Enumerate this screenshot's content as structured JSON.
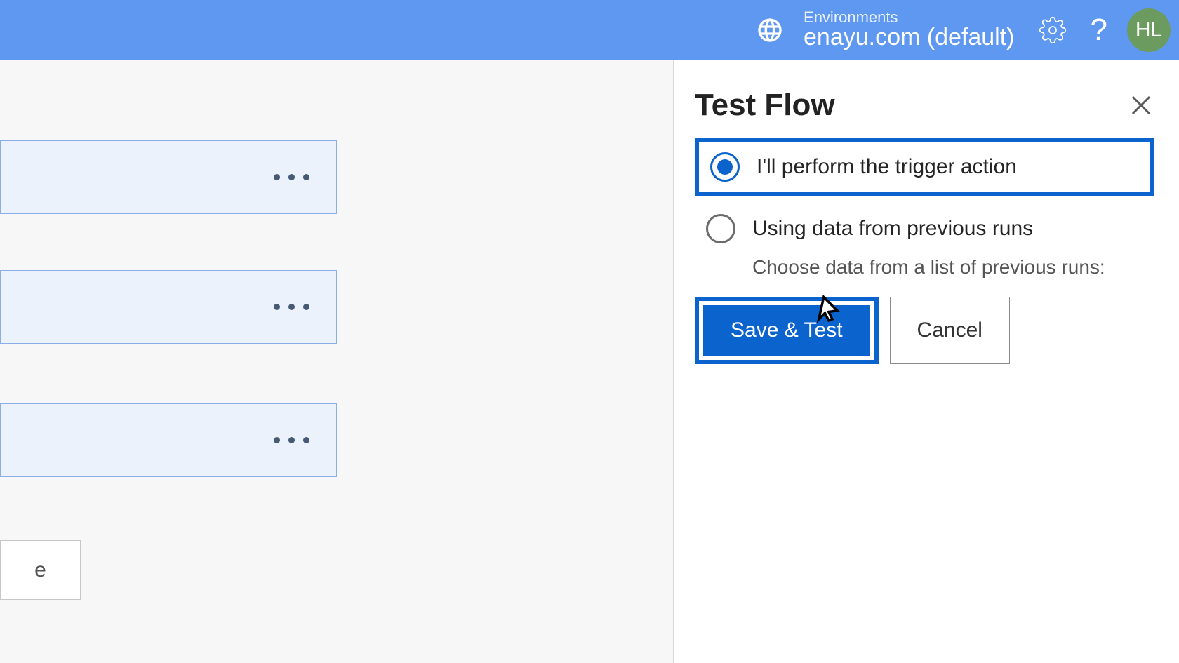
{
  "header": {
    "environments_label": "Environments",
    "environment_value": "enayu.com (default)",
    "avatar_initials": "HL"
  },
  "canvas": {
    "new_step_placeholder": "e"
  },
  "panel": {
    "title": "Test Flow",
    "option_perform": "I'll perform the trigger action",
    "option_previous": "Using data from previous runs",
    "option_previous_sub": "Choose data from a list of previous runs:",
    "save_button": "Save & Test",
    "cancel_button": "Cancel"
  }
}
